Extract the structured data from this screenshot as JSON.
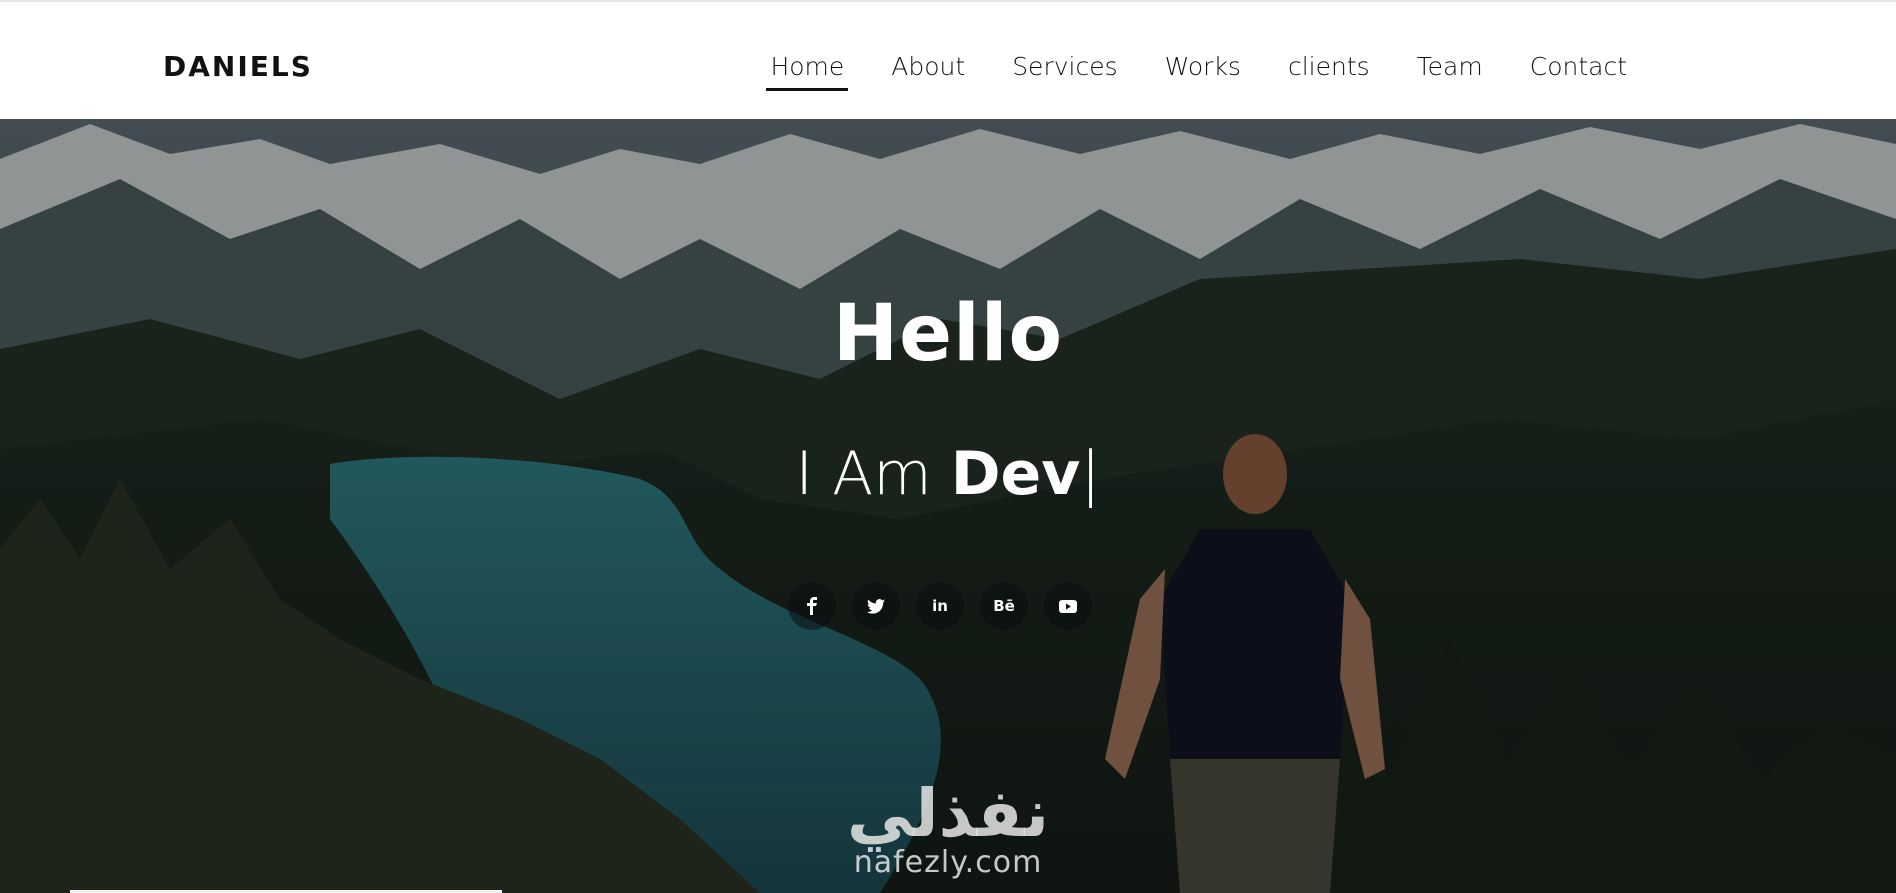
{
  "brand": "DANIELS",
  "nav": {
    "items": [
      {
        "label": "Home",
        "active": true
      },
      {
        "label": "About"
      },
      {
        "label": "Services"
      },
      {
        "label": "Works"
      },
      {
        "label": "clients"
      },
      {
        "label": "Team"
      },
      {
        "label": "Contact"
      }
    ]
  },
  "hero": {
    "title": "Hello",
    "subtitle_prefix": "I Am ",
    "subtitle_role": "Dev",
    "cursor": "|",
    "social": [
      {
        "icon": "facebook-icon",
        "glyph": "f"
      },
      {
        "icon": "twitter-icon",
        "glyph": ""
      },
      {
        "icon": "linkedin-icon",
        "glyph": "in"
      },
      {
        "icon": "behance-icon",
        "glyph": "Bē"
      },
      {
        "icon": "youtube-icon",
        "glyph": ""
      }
    ]
  },
  "watermark": {
    "arabic": "نفذلي",
    "latin": "nafezly.com"
  },
  "colors": {
    "nav_bg": "#ffffff",
    "text_dark": "#141414",
    "hero_text": "#ffffff"
  }
}
